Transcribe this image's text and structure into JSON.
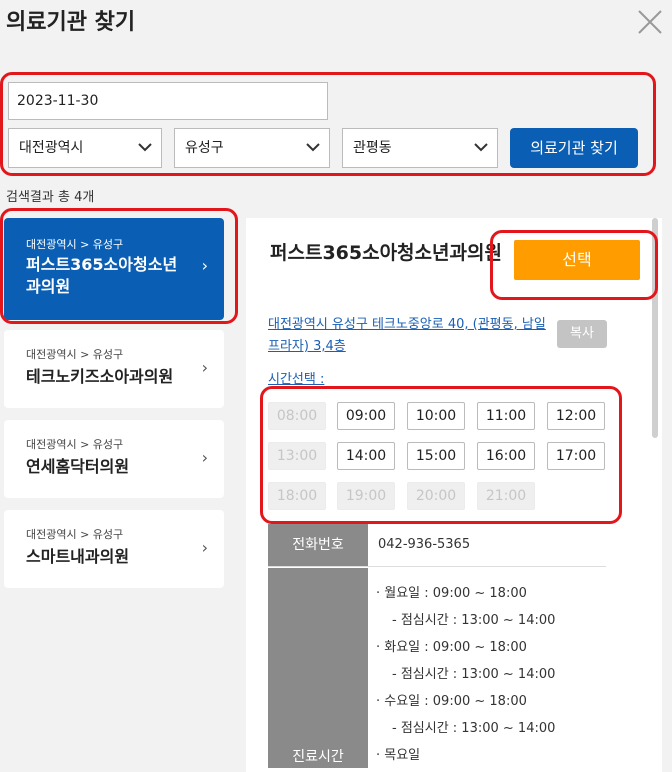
{
  "window": {
    "title": "의료기관 찾기"
  },
  "search": {
    "date_value": "2023-11-30",
    "city": "대전광역시",
    "district": "유성구",
    "dong": "관평동",
    "button_label": "의료기관 찾기"
  },
  "results": {
    "count_text": "검색결과 총 4개",
    "items": [
      {
        "region": "대전광역시 > 유성구",
        "name": "퍼스트365소아청소년과의원"
      },
      {
        "region": "대전광역시 > 유성구",
        "name": "테크노키즈소아과의원"
      },
      {
        "region": "대전광역시 > 유성구",
        "name": "연세홈닥터의원"
      },
      {
        "region": "대전광역시 > 유성구",
        "name": "스마트내과의원"
      }
    ]
  },
  "detail": {
    "name": "퍼스트365소아청소년과의원",
    "select_label": "선택",
    "address": "대전광역시 유성구 테크노중앙로 40, (관평동, 남일프라자) 3,4층",
    "copy_label": "복사",
    "time_label": "시간선택 :",
    "slots": [
      {
        "time": "08:00",
        "enabled": false
      },
      {
        "time": "09:00",
        "enabled": true
      },
      {
        "time": "10:00",
        "enabled": true
      },
      {
        "time": "11:00",
        "enabled": true
      },
      {
        "time": "12:00",
        "enabled": true
      },
      {
        "time": "13:00",
        "enabled": false
      },
      {
        "time": "14:00",
        "enabled": true
      },
      {
        "time": "15:00",
        "enabled": true
      },
      {
        "time": "16:00",
        "enabled": true
      },
      {
        "time": "17:00",
        "enabled": true
      },
      {
        "time": "18:00",
        "enabled": false
      },
      {
        "time": "19:00",
        "enabled": false
      },
      {
        "time": "20:00",
        "enabled": false
      },
      {
        "time": "21:00",
        "enabled": false
      }
    ],
    "phone_label": "전화번호",
    "phone": "042-936-5365",
    "hours_label": "진료시간",
    "hours": [
      "· 월요일 : 09:00 ~ 18:00",
      "- 점심시간 : 13:00 ~ 14:00",
      "· 화요일 : 09:00 ~ 18:00",
      "- 점심시간 : 13:00 ~ 14:00",
      "· 수요일 : 09:00 ~ 18:00",
      "- 점심시간 : 13:00 ~ 14:00",
      "· 목요일"
    ]
  },
  "colors": {
    "primary": "#0a5fb4",
    "accent": "#ff9c00",
    "highlight": "#e3161c"
  }
}
